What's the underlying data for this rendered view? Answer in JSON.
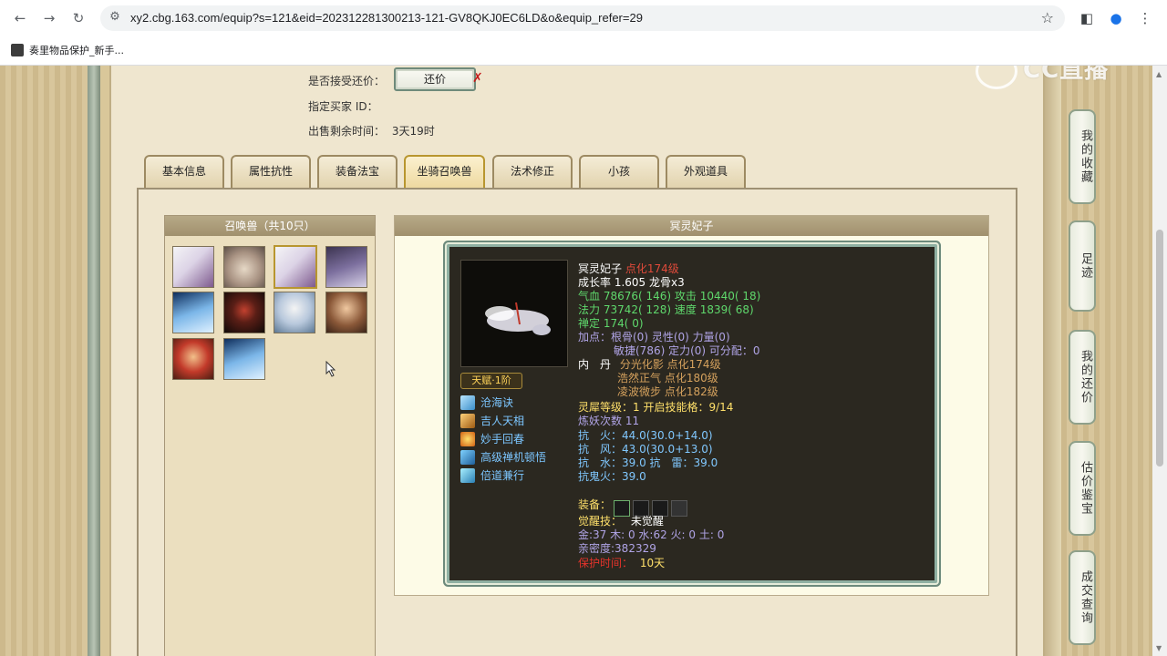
{
  "browser": {
    "url": "xy2.cbg.163.com/equip?s=121&eid=202312281300213-121-GV8QKJ0EC6LD&o&equip_refer=29",
    "bookmark": "奏里物品保护_新手..."
  },
  "watermark": "CC直播",
  "listing": {
    "accept_counter_label": "是否接受还价：",
    "counter_button": "还价",
    "buyer_label": "指定买家 ID：",
    "time_label": "出售剩余时间：",
    "time_value": "3天19时"
  },
  "tabs": [
    "基本信息",
    "属性抗性",
    "装备法宝",
    "坐骑召唤兽",
    "法术修正",
    "小孩",
    "外观道具"
  ],
  "pet_list": {
    "title": "召唤兽（共10只）"
  },
  "detail": {
    "title": "冥灵妃子",
    "name": "冥灵妃子",
    "level": "点化174级",
    "growth": "成长率 1.605 龙骨x3",
    "hp_line": "气血 78676( 146) 攻击 10440( 18)",
    "mp_line": "法力 73742( 128) 速度 1839( 68)",
    "zen_line": "禅定 174( 0)",
    "points_line1": "加点：根骨(0) 灵性(0) 力量(0)",
    "points_line2": "敏捷(786) 定力(0) 可分配：0",
    "neidan_label": "内　丹",
    "neidan1": "分光化影 点化174级",
    "neidan2": "浩然正气 点化180级",
    "neidan3": "凌波微步 点化182级",
    "lingxi": "灵犀等级：1 开启技能格：9/14",
    "lianyao": "炼妖次数 11",
    "res_fire": "抗　火：44.0(30.0+14.0)",
    "res_wind": "抗　风：43.0(30.0+13.0)",
    "res_water": "抗　水：39.0 抗　雷：39.0",
    "res_ghost": "抗鬼火：39.0",
    "equip_label": "装备：",
    "awaken_label": "觉醒技：",
    "awaken_value": "未觉醒",
    "elements": "金:37 木: 0 水:62 火: 0 土: 0",
    "intimacy": "亲密度:382329",
    "protect_label": "保护时间：",
    "protect_value": "10天",
    "talent": "天赋·1阶",
    "skills": [
      "沧海诀",
      "吉人天相",
      "妙手回春",
      "高级禅机顿悟",
      "倍道兼行"
    ]
  },
  "side_buttons": [
    "我的收藏",
    "足迹",
    "我的还价",
    "估价鉴宝",
    "成交查询"
  ],
  "colors": {
    "accent_gold": "#b8962f",
    "card_bg": "#2b2820",
    "skill_blue": "#7cc6ff"
  }
}
